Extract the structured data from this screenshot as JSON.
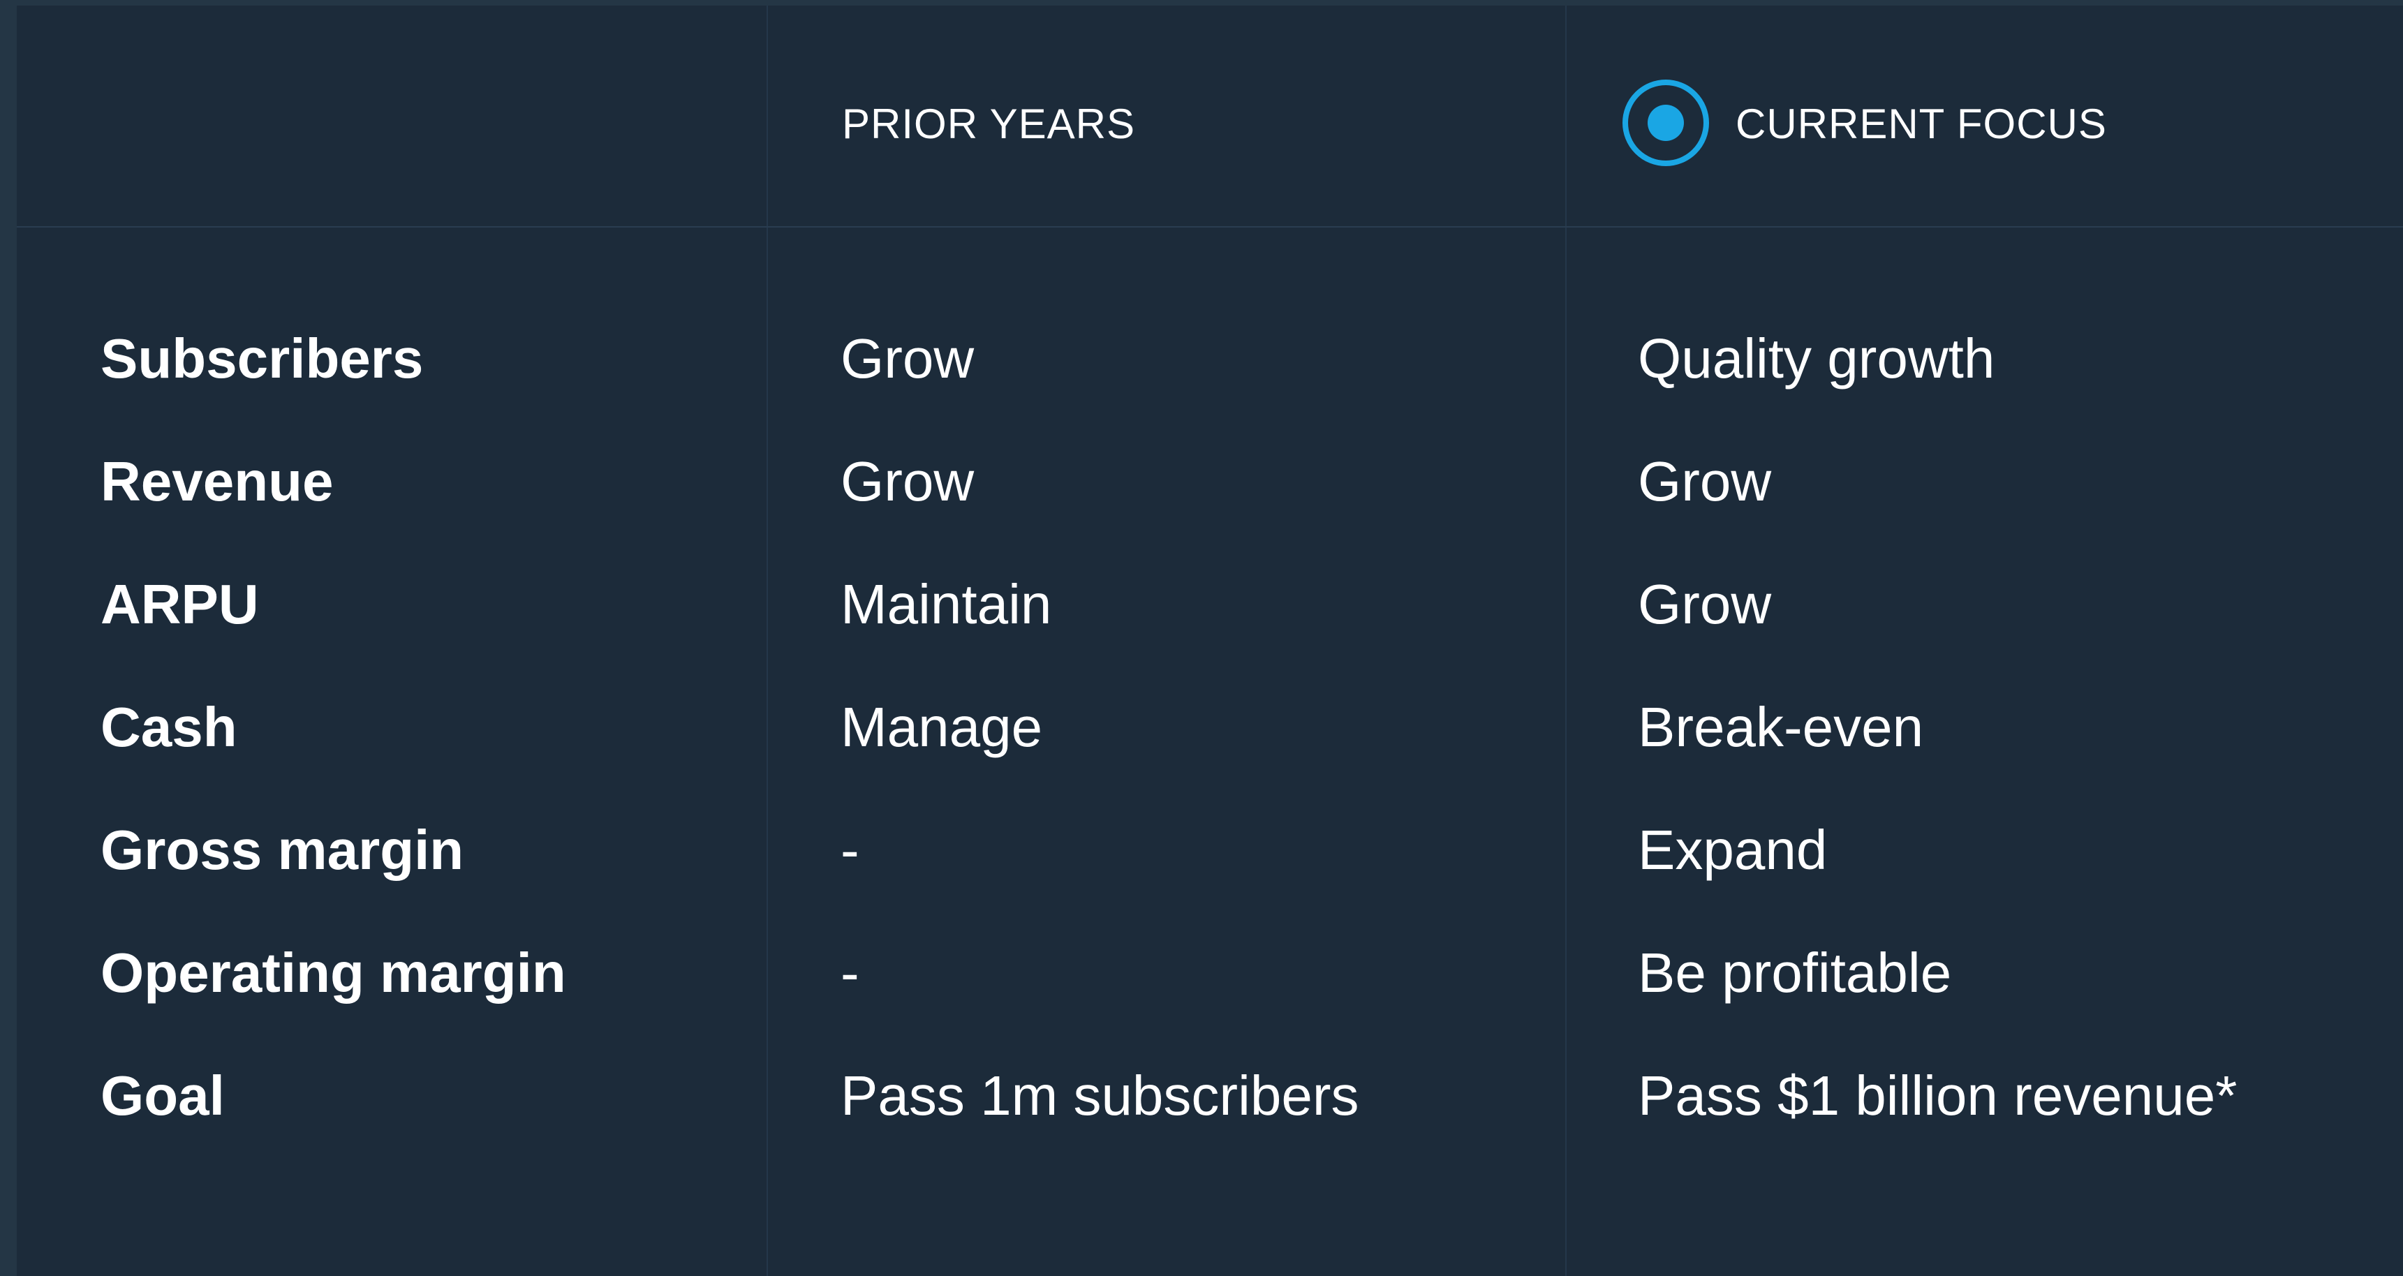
{
  "header": {
    "prior_label": "PRIOR YEARS",
    "current_label": "CURRENT FOCUS"
  },
  "rows": [
    {
      "metric": "Subscribers",
      "prior": "Grow",
      "current": "Quality growth"
    },
    {
      "metric": "Revenue",
      "prior": "Grow",
      "current": "Grow"
    },
    {
      "metric": "ARPU",
      "prior": "Maintain",
      "current": "Grow"
    },
    {
      "metric": "Cash",
      "prior": "Manage",
      "current": "Break-even"
    },
    {
      "metric": "Gross margin",
      "prior": "-",
      "current": "Expand"
    },
    {
      "metric": "Operating margin",
      "prior": "-",
      "current": "Be profitable"
    },
    {
      "metric": "Goal",
      "prior": "Pass 1m subscribers",
      "current": "Pass $1 billion revenue*"
    }
  ],
  "colors": {
    "background": "#1c2b3a",
    "accent": "#1aa6e4",
    "text": "#ffffff"
  },
  "icons": {
    "current_focus": "radio-selected-icon"
  }
}
